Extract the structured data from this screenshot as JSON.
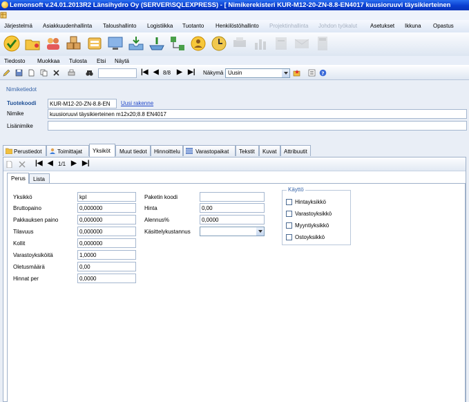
{
  "window": {
    "title": "Lemonsoft v.24.01.2013R2 Länsihydro Oy (SERVER\\SQLEXPRESS) - [ Nimikerekisteri KUR-M12-20-ZN-8.8-EN4017 kuusioruuvi täysikierteinen"
  },
  "main_menu": [
    {
      "label": "Järjestelmä",
      "enabled": true
    },
    {
      "label": "Asiakkuudenhallinta",
      "enabled": true
    },
    {
      "label": "Taloushallinto",
      "enabled": true
    },
    {
      "label": "Logistiikka",
      "enabled": true
    },
    {
      "label": "Tuotanto",
      "enabled": true
    },
    {
      "label": "Henkilöstöhallinto",
      "enabled": true
    },
    {
      "label": "Projektinhallinta",
      "enabled": false
    },
    {
      "label": "Johdon työkalut",
      "enabled": false
    },
    {
      "label": "Asetukset",
      "enabled": true
    },
    {
      "label": "Ikkuna",
      "enabled": true
    },
    {
      "label": "Opastus",
      "enabled": true
    }
  ],
  "sub_menu": [
    "Tiedosto",
    "Muokkaa",
    "Tulosta",
    "Etsi",
    "Näytä"
  ],
  "record_toolbar": {
    "position": "8/8",
    "view_label": "Näkymä",
    "view_value": "Uusin"
  },
  "nimiketiedot": {
    "legend": "Nimiketiedot",
    "tuotekoodi_label": "Tuotekoodi",
    "tuotekoodi_value": "KUR-M12-20-ZN-8.8-EN",
    "uusi_rakenne": "Uusi rakenne",
    "nimike_label": "Nimike",
    "nimike_value": "kuusioruuvi täysikierteinen m12x20;8.8 EN4017",
    "lisanimike_label": "Lisänimike",
    "lisanimike_value": ""
  },
  "tabs": [
    "Perustiedot",
    "Toimittajat",
    "Yksiköt",
    "Muut tiedot",
    "Hinnoittelu",
    "Varastopaikat",
    "Tekstit",
    "Kuvat",
    "Attribuutit"
  ],
  "sub_toolbar": {
    "position": "1/1"
  },
  "inner_tabs": [
    "Perus",
    "Lista"
  ],
  "fields_left": [
    {
      "label": "Yksikkö",
      "value": "kpl"
    },
    {
      "label": "Bruttopaino",
      "value": "0,000000"
    },
    {
      "label": "Pakkauksen paino",
      "value": "0,000000"
    },
    {
      "label": "Tilavuus",
      "value": "0,000000"
    },
    {
      "label": "Kollit",
      "value": "0,000000"
    },
    {
      "label": "Varastoyksiköitä",
      "value": "1,0000"
    },
    {
      "label": "Oletusmäärä",
      "value": "0,00"
    },
    {
      "label": "Hinnat per",
      "value": "0,0000"
    }
  ],
  "fields_mid": [
    {
      "label": "Paketin koodi",
      "value": ""
    },
    {
      "label": "Hinta",
      "value": "0,00"
    },
    {
      "label": "Alennus%",
      "value": "0,0000"
    },
    {
      "label": "Käsittelykustannus",
      "value": ""
    }
  ],
  "kaytto": {
    "legend": "Käyttö",
    "options": [
      {
        "label": "Hintayksikkö",
        "checked": false
      },
      {
        "label": "Varastoyksikkö",
        "checked": false
      },
      {
        "label": "Myyntiyksikkö",
        "checked": false
      },
      {
        "label": "Ostoyksikkö",
        "checked": false
      }
    ]
  },
  "colors": {
    "titlebar": "#0a3ed0",
    "accent": "#1f4f95",
    "link": "#1f46c8"
  }
}
